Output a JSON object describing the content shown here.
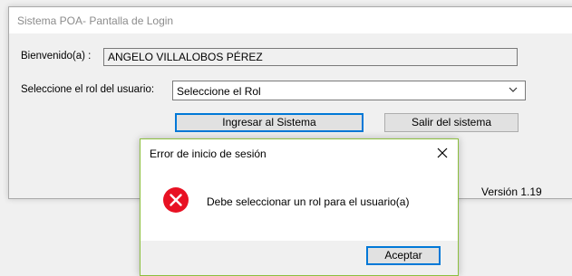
{
  "window": {
    "title": "Sistema POA- Pantalla de Login",
    "welcome_label": "Bienvenido(a) :",
    "welcome_value": "ANGELO VILLALOBOS PÉREZ",
    "role_label": "Seleccione el rol del usuario:",
    "role_select_value": "Seleccione el Rol",
    "login_button": "Ingresar al Sistema",
    "exit_button": "Salir del sistema",
    "version": "Versión 1.19"
  },
  "dialog": {
    "title": "Error de inicio de sesión",
    "message": "Debe seleccionar un rol para el usuario(a)",
    "ok_button": "Aceptar",
    "icon": "error-icon",
    "colors": {
      "error": "#e81123",
      "accent": "#0078d7",
      "dialog_border": "#8cbf3f"
    }
  }
}
